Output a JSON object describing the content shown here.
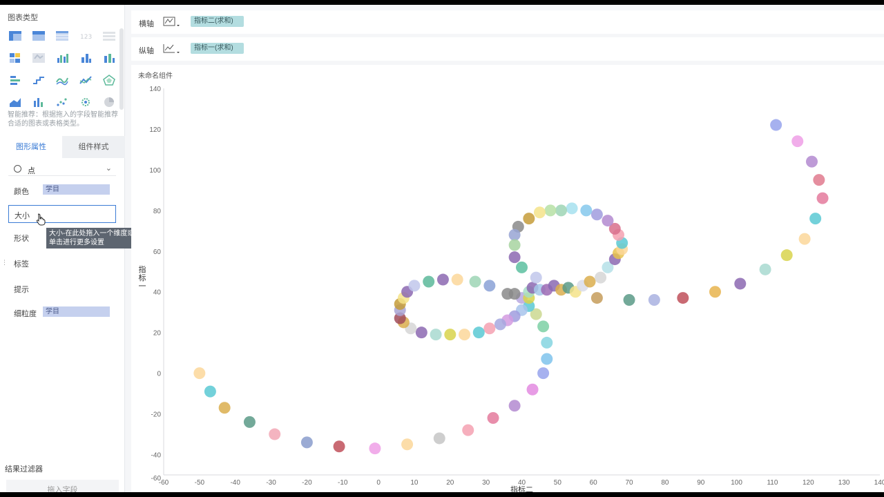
{
  "left_panel": {
    "chart_type_title": "图表类型",
    "smart_hint": "智能推荐：根据拖入的字段智能推荐合适的图表或表格类型。",
    "tabs": {
      "properties": "图形属性",
      "component_style": "组件样式"
    },
    "mark_type": "点",
    "rows": {
      "color": {
        "label": "颜色",
        "value": "学目"
      },
      "size": {
        "label": "大小"
      },
      "shape": {
        "label": "形状"
      },
      "label": {
        "label": "标签"
      },
      "tooltip": {
        "label": "提示"
      },
      "granularity": {
        "label": "细粒度",
        "value": "学目"
      }
    },
    "size_tooltip": "大小-在此处拖入一个维度或一个指标，或者单击进行更多设置",
    "filter_title": "结果过滤器",
    "filter_drop": "拖入字段"
  },
  "axes_bar": {
    "x_axis_label": "横轴",
    "x_axis_field": "指标二(求和)",
    "y_axis_label": "纵轴",
    "y_axis_field": "指标一(求和)"
  },
  "component_title": "未命名组件",
  "colors": {
    "accent": "#3a7bd5",
    "field_pill": "#b3dde0",
    "color_pill": "#c5d0ee"
  },
  "chart_data": {
    "type": "scatter",
    "xlabel": "指标二",
    "ylabel": "指标一",
    "xlim": [
      -60,
      140
    ],
    "ylim": [
      -50,
      140
    ],
    "xticks": [
      -60,
      -50,
      -40,
      -30,
      -20,
      -10,
      0,
      10,
      20,
      30,
      40,
      50,
      60,
      70,
      80,
      90,
      100,
      110,
      120,
      130,
      140
    ],
    "yticks": [
      -60,
      -40,
      -20,
      0,
      20,
      40,
      60,
      80,
      100,
      120,
      140
    ],
    "grid": false,
    "points": [
      [
        -50,
        0,
        "#fcd79a"
      ],
      [
        -47,
        -9,
        "#5ac9d3"
      ],
      [
        -43,
        -17,
        "#dbae4e"
      ],
      [
        -36,
        -24,
        "#5a9a87"
      ],
      [
        -29,
        -30,
        "#f2a7b5"
      ],
      [
        -20,
        -34,
        "#8a9ccc"
      ],
      [
        -11,
        -36,
        "#c0505a"
      ],
      [
        -1,
        -37,
        "#ef9fe6"
      ],
      [
        8,
        -35,
        "#fcd79a"
      ],
      [
        17,
        -32,
        "#c6c6c6"
      ],
      [
        25,
        -28,
        "#f5a1b2"
      ],
      [
        32,
        -22,
        "#e47a9c"
      ],
      [
        38,
        -16,
        "#b389d0"
      ],
      [
        43,
        -8,
        "#e38be0"
      ],
      [
        46,
        0,
        "#97a3ec"
      ],
      [
        47,
        7,
        "#7fc3ec"
      ],
      [
        47,
        15,
        "#85d5e0"
      ],
      [
        46,
        23,
        "#7cd0a4"
      ],
      [
        44,
        29,
        "#cbd890"
      ],
      [
        42,
        33,
        "#5ac9d3"
      ],
      [
        40,
        31,
        "#a8c4ec"
      ],
      [
        38,
        28,
        "#a09cde"
      ],
      [
        36,
        26,
        "#d39be0"
      ],
      [
        34,
        24,
        "#a6a8df"
      ],
      [
        31,
        22,
        "#f5a1b2"
      ],
      [
        28,
        20,
        "#5ac9d3"
      ],
      [
        24,
        19,
        "#fcd79a"
      ],
      [
        20,
        19,
        "#d8d34c"
      ],
      [
        16,
        19,
        "#a8d9d0"
      ],
      [
        12,
        20,
        "#8c69b2"
      ],
      [
        9,
        22,
        "#d6d6d6"
      ],
      [
        7,
        25,
        "#dbae4e"
      ],
      [
        6,
        27,
        "#a14c5a"
      ],
      [
        6,
        31,
        "#a9a4d4"
      ],
      [
        6,
        34,
        "#c59c3a"
      ],
      [
        7,
        37,
        "#f5e38a"
      ],
      [
        8,
        40,
        "#8c69b2"
      ],
      [
        10,
        43,
        "#c1c7eb"
      ],
      [
        14,
        45,
        "#5cb99a"
      ],
      [
        18,
        46,
        "#8c69b2"
      ],
      [
        22,
        46,
        "#fcd79a"
      ],
      [
        27,
        45,
        "#9ed5b5"
      ],
      [
        31,
        43,
        "#8aa1d6"
      ],
      [
        36,
        39,
        "#8a8a8a"
      ],
      [
        40,
        37,
        "#b9a8e0"
      ],
      [
        42,
        37,
        "#d8d34c"
      ],
      [
        42,
        40,
        "#a7ddc5"
      ],
      [
        43,
        42,
        "#8c69b2"
      ],
      [
        45,
        41,
        "#a4c8e9"
      ],
      [
        47,
        41,
        "#9c6ab4"
      ],
      [
        49,
        43,
        "#8a69b2"
      ],
      [
        51,
        41,
        "#dbae4e"
      ],
      [
        53,
        42,
        "#5a9a87"
      ],
      [
        55,
        40,
        "#f5e38a"
      ],
      [
        57,
        43,
        "#d9dce9"
      ],
      [
        59,
        45,
        "#dbae4e"
      ],
      [
        62,
        47,
        "#d6d6d6"
      ],
      [
        64,
        52,
        "#b5e0e8"
      ],
      [
        66,
        56,
        "#8c69b2"
      ],
      [
        67,
        59,
        "#e8c24e"
      ],
      [
        68,
        61,
        "#fcd79a"
      ],
      [
        68,
        64,
        "#5ac9d3"
      ],
      [
        67,
        68,
        "#f5a1b2"
      ],
      [
        66,
        71,
        "#d86f8c"
      ],
      [
        64,
        75,
        "#b389d0"
      ],
      [
        61,
        78,
        "#a09cde"
      ],
      [
        58,
        80,
        "#85c8ec"
      ],
      [
        54,
        81,
        "#a6e0ef"
      ],
      [
        51,
        80,
        "#9ed5b5"
      ],
      [
        48,
        80,
        "#b6e0a5"
      ],
      [
        45,
        79,
        "#f5e38a"
      ],
      [
        42,
        76,
        "#c59c3a"
      ],
      [
        39,
        72,
        "#8a8a8a"
      ],
      [
        38,
        68,
        "#98a4d4"
      ],
      [
        38,
        63,
        "#a7d3a0"
      ],
      [
        38,
        57,
        "#8c69b2"
      ],
      [
        40,
        52,
        "#5cc0a0"
      ],
      [
        44,
        47,
        "#c1c7eb"
      ],
      [
        38,
        39,
        "#8a8a8a"
      ],
      [
        61,
        37,
        "#c59c5a"
      ],
      [
        70,
        36,
        "#5a9a87"
      ],
      [
        77,
        36,
        "#a9b2e0"
      ],
      [
        85,
        37,
        "#c0505a"
      ],
      [
        94,
        40,
        "#e8b44e"
      ],
      [
        101,
        44,
        "#8c69b2"
      ],
      [
        108,
        51,
        "#a8d9d0"
      ],
      [
        114,
        58,
        "#d8d34c"
      ],
      [
        119,
        66,
        "#fcd79a"
      ],
      [
        122,
        76,
        "#5ac9d3"
      ],
      [
        124,
        86,
        "#e47a9c"
      ],
      [
        123,
        95,
        "#e07a8e"
      ],
      [
        121,
        104,
        "#b389d0"
      ],
      [
        117,
        114,
        "#ef9fe6"
      ],
      [
        111,
        122,
        "#97a3ec"
      ]
    ]
  }
}
